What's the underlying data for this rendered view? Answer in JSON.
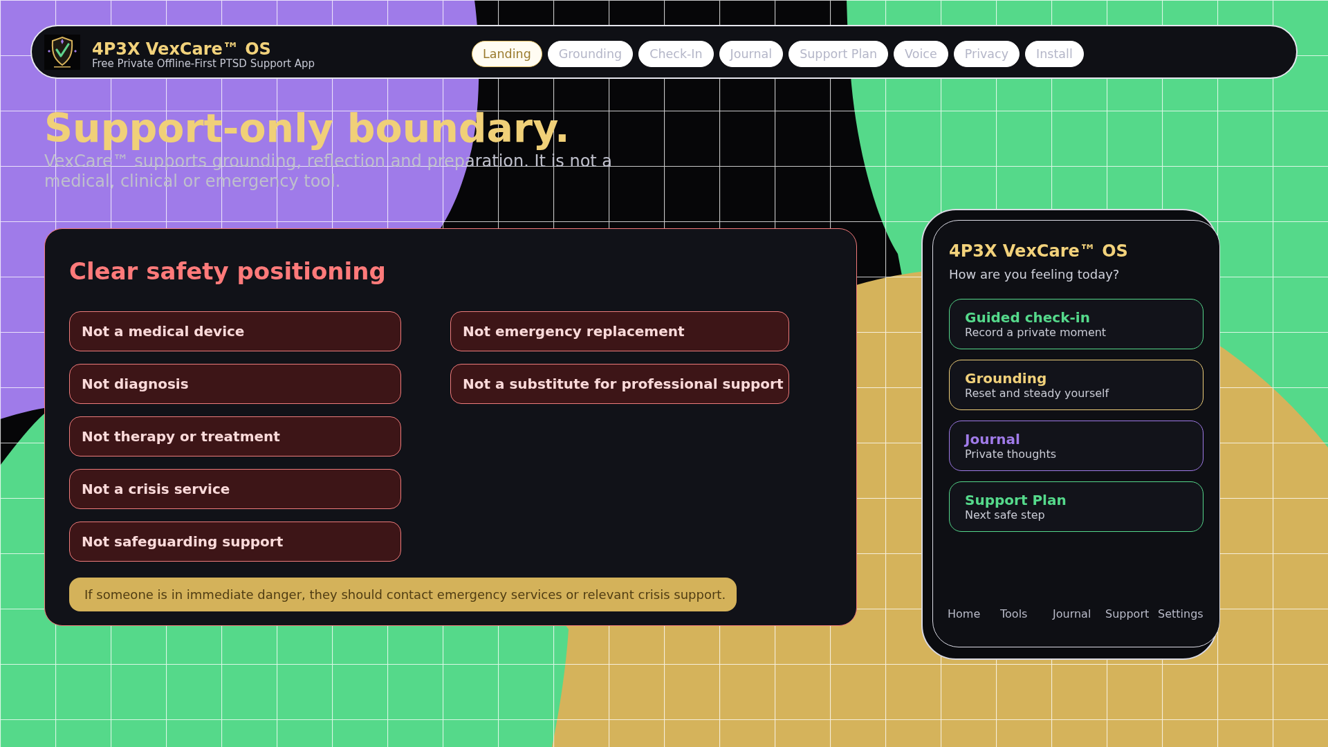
{
  "header": {
    "title": "4P3X VexCare™ OS",
    "subtitle": "Free Private Offline-First PTSD Support App",
    "nav": [
      {
        "label": "Landing",
        "selected": true
      },
      {
        "label": "Grounding",
        "selected": false
      },
      {
        "label": "Check-In",
        "selected": false
      },
      {
        "label": "Journal",
        "selected": false
      },
      {
        "label": "Support Plan",
        "selected": false
      },
      {
        "label": "Voice",
        "selected": false
      },
      {
        "label": "Privacy",
        "selected": false
      },
      {
        "label": "Install",
        "selected": false
      }
    ]
  },
  "hero": {
    "title": "Support-only boundary.",
    "text": "VexCare™ supports grounding, reflection and preparation. It is not a medical, clinical or emergency tool."
  },
  "safety_card": {
    "title": "Clear safety positioning",
    "columns": [
      {
        "items": [
          "Not a medical device",
          "Not diagnosis",
          "Not therapy or treatment",
          "Not a crisis service",
          "Not safeguarding support"
        ]
      },
      {
        "items": [
          "Not emergency replacement",
          "Not a substitute for professional support"
        ]
      }
    ],
    "notice": "If someone is in immediate danger, they should contact emergency services or relevant crisis support."
  },
  "phone": {
    "title": "4P3X VexCare™ OS",
    "prompt": "How are you feeling today?",
    "cards": [
      {
        "title": "Guided check-in",
        "subtitle": "Record a private moment",
        "color": "#55d98b"
      },
      {
        "title": "Grounding",
        "subtitle": "Reset and steady yourself",
        "color": "#f0d07a"
      },
      {
        "title": "Journal",
        "subtitle": "Private thoughts",
        "color": "#a07be9"
      },
      {
        "title": "Support Plan",
        "subtitle": "Next safe step",
        "color": "#55d98b"
      }
    ],
    "bottom_nav": [
      "Home",
      "Tools",
      "Journal",
      "Support",
      "Settings"
    ]
  }
}
